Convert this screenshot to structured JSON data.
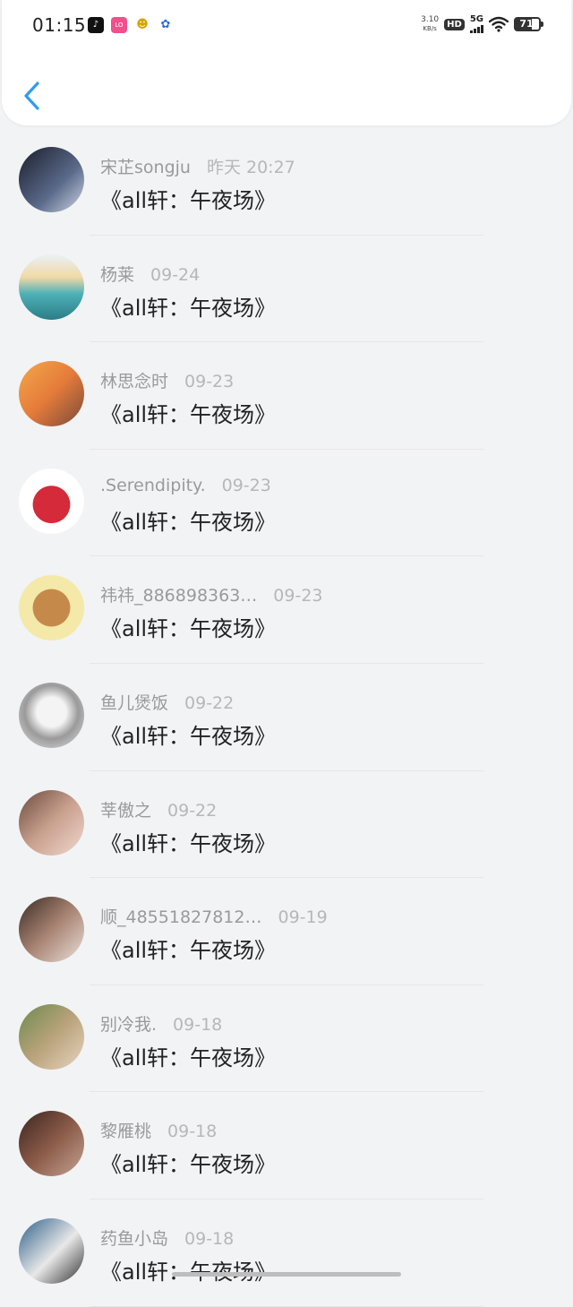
{
  "status_bar": {
    "time": "01:15",
    "app_icons": [
      "tiktok-icon",
      "lofter-icon",
      "qq-icon",
      "baidu-icon"
    ],
    "net_speed_value": "3.10",
    "net_speed_unit": "KB/s",
    "hd_label": "HD",
    "network_label": "5G",
    "battery_level": "71"
  },
  "header": {
    "back_icon": "chevron-left-icon",
    "accent_color": "#2f9bef"
  },
  "comments": [
    {
      "user": "宋芷songju",
      "date": "昨天 20:27",
      "title": "《all轩：午夜场》",
      "avatar_bg": "linear-gradient(135deg,#1b1d2b,#5a6a8a 60%,#cfd6e4)"
    },
    {
      "user": "杨莱",
      "date": "09-24",
      "title": "《all轩：午夜场》",
      "avatar_bg": "linear-gradient(180deg,#eaf1f6 0%,#f0d9a6 35%,#4fb0b7 60%,#2a7e87 100%)"
    },
    {
      "user": "林思念时",
      "date": "09-23",
      "title": "《all轩：午夜场》",
      "avatar_bg": "linear-gradient(135deg,#f3a84c,#e57b3a 50%,#7a4a3a)"
    },
    {
      "user": ".Serendipity.",
      "date": "09-23",
      "title": "《all轩：午夜场》",
      "avatar_bg": "radial-gradient(circle at 50% 55%,#d42a3a 0 38%,#ffffff 39%)"
    },
    {
      "user": "祎祎_886898363…",
      "date": "09-23",
      "title": "《all轩：午夜场》",
      "avatar_bg": "radial-gradient(circle at 50% 50%,#c58a4a 0 40%,#f4e9a8 41%)"
    },
    {
      "user": "鱼儿煲饭",
      "date": "09-22",
      "title": "《all轩：午夜场》",
      "avatar_bg": "radial-gradient(circle at 50% 45%,#f4f4f4 0 30%,#9a9a9a 55%,#e6e6e6)"
    },
    {
      "user": "莘傲之",
      "date": "09-22",
      "title": "《all轩：午夜场》",
      "avatar_bg": "linear-gradient(135deg,#6a4a3f,#c9a08e 50%,#f0d8cf)"
    },
    {
      "user": "顺_48551827812…",
      "date": "09-19",
      "title": "《all轩：午夜场》",
      "avatar_bg": "linear-gradient(135deg,#3a2b25,#a88372 50%,#e9e0da)"
    },
    {
      "user": "别冷我.",
      "date": "09-18",
      "title": "《all轩：午夜场》",
      "avatar_bg": "linear-gradient(135deg,#6b8a4e,#b8a27a 50%,#e8d4c0)"
    },
    {
      "user": "黎雁桃",
      "date": "09-18",
      "title": "《all轩：午夜场》",
      "avatar_bg": "linear-gradient(135deg,#3a2520,#8a5a48 50%,#c6a292)"
    },
    {
      "user": "药鱼小岛",
      "date": "09-18",
      "title": "《all轩：午夜场》",
      "avatar_bg": "linear-gradient(135deg,#2d5f8a,#e8e8e8 55%,#303030)"
    }
  ]
}
